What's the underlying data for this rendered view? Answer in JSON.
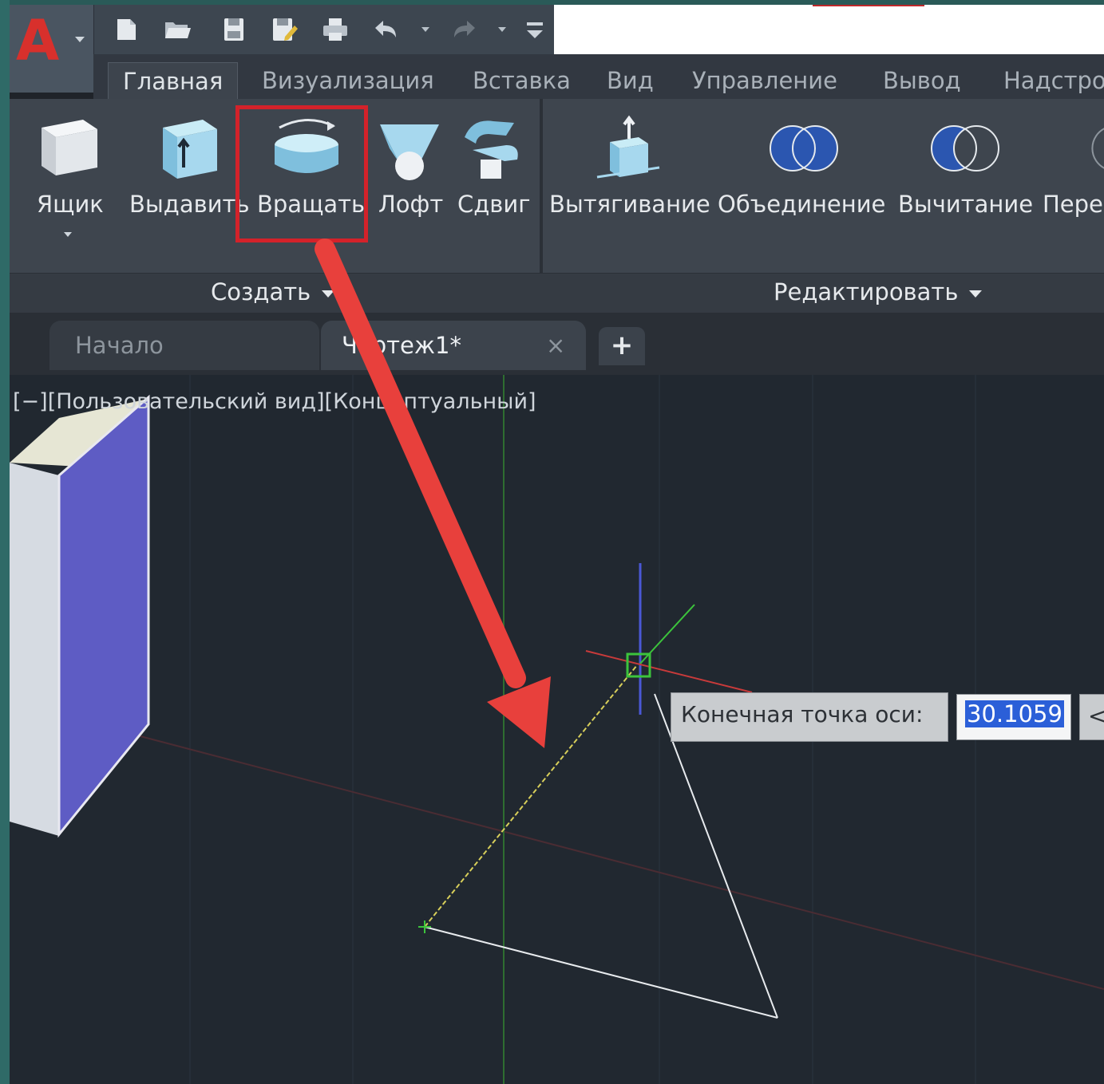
{
  "app": {
    "logo_letter": "A"
  },
  "ribbon_tabs": [
    "Главная",
    "Визуализация",
    "Вставка",
    "Вид",
    "Управление",
    "Вывод",
    "Надстро"
  ],
  "create_panel": {
    "tools": [
      "Ящик",
      "Выдавить",
      "Вращать",
      "Лофт",
      "Сдвиг"
    ],
    "title": "Создать"
  },
  "edit_panel": {
    "tools": [
      "Вытягивание",
      "Объединение",
      "Вычитание",
      "Пере"
    ],
    "title": "Редактировать"
  },
  "file_tabs": [
    {
      "label": "Начало"
    },
    {
      "label": "Чертеж1*",
      "close": "×"
    }
  ],
  "new_tab_label": "+",
  "viewport": {
    "label": "[−][Пользовательский вид][Концептуальный]",
    "prompt_label": "Конечная точка оси:",
    "prompt_value": "30.1059",
    "prompt_more": "<"
  },
  "colors": {
    "accent_red": "#d3222a",
    "logo_red": "#d8302c",
    "ucs_blue": "#4a58d6",
    "ucs_green": "#3cc43c",
    "ucs_red": "#c83a3a",
    "box_side": "#5e5cc4",
    "selection_blue": "#2b5fd8"
  },
  "icons": {
    "qat": [
      "new-icon",
      "open-icon",
      "save-icon",
      "save-as-icon",
      "print-icon",
      "undo-icon",
      "redo-icon",
      "customize-icon"
    ],
    "create": [
      "box-icon",
      "extrude-icon",
      "revolve-icon",
      "loft-icon",
      "sweep-icon"
    ],
    "edit": [
      "presspull-icon",
      "union-icon",
      "subtract-icon"
    ]
  }
}
